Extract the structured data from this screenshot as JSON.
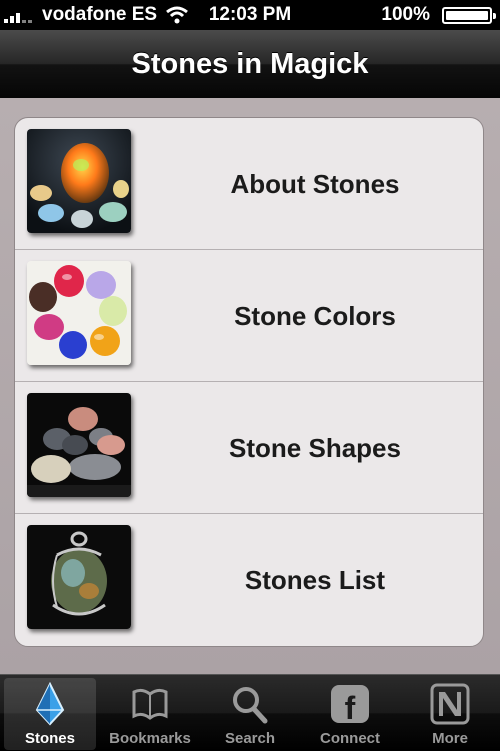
{
  "status_bar": {
    "carrier": "vodafone ES",
    "time": "12:03 PM",
    "battery": "100%"
  },
  "nav": {
    "title": "Stones in Magick"
  },
  "menu": [
    {
      "label": "About Stones",
      "icon": "opal-stones-photo"
    },
    {
      "label": "Stone Colors",
      "icon": "colored-stones-photo"
    },
    {
      "label": "Stone Shapes",
      "icon": "pebbles-photo"
    },
    {
      "label": "Stones List",
      "icon": "wire-wrapped-pendant-photo"
    }
  ],
  "tabs": [
    {
      "label": "Stones",
      "icon": "crystal-icon",
      "active": true
    },
    {
      "label": "Bookmarks",
      "icon": "book-icon",
      "active": false
    },
    {
      "label": "Search",
      "icon": "magnifier-icon",
      "active": false
    },
    {
      "label": "Connect",
      "icon": "facebook-icon",
      "active": false
    },
    {
      "label": "More",
      "icon": "more-icon",
      "active": false
    }
  ],
  "colors": {
    "nav_bar": "#1e1e1e",
    "content_bg": "#b2a9ac",
    "list_bg": "#ebe8e9",
    "tab_active": "#ffffff",
    "tab_inactive": "#9a9a9a",
    "crystal_blue": "#3aa0e8"
  }
}
